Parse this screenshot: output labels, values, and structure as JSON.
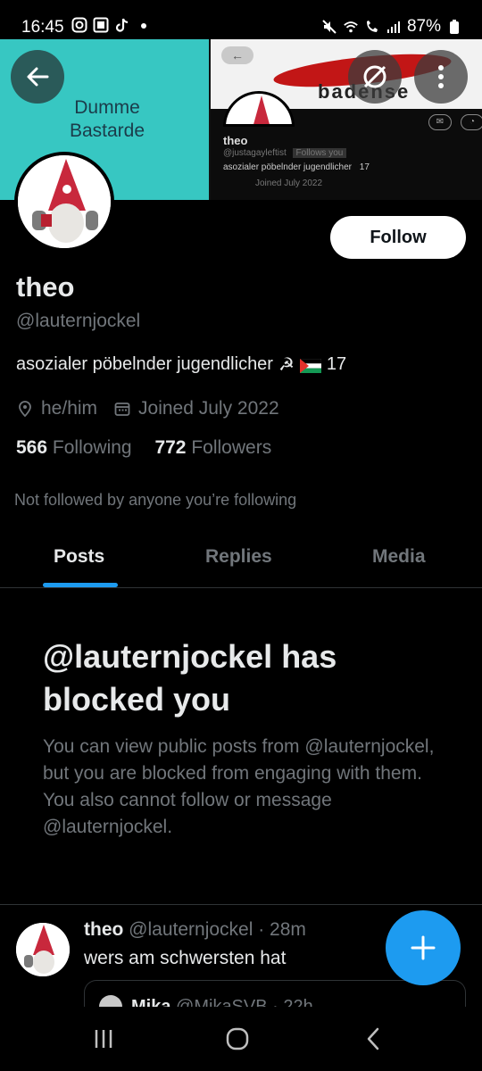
{
  "status_bar": {
    "time": "16:45",
    "battery": "87%",
    "icons_left": [
      "instagram-icon",
      "app-icon",
      "tiktok-icon",
      "dot-icon"
    ],
    "icons_right": [
      "mute-icon",
      "wifi-icon",
      "wifi-call-icon",
      "signal-icon",
      "battery-icon"
    ]
  },
  "banner": {
    "left_text_line1": "Dumme",
    "left_text_line2": "Bastarde",
    "right_image": {
      "caption": "badense",
      "name": "theo",
      "handle": "@justagayleftist",
      "follows_you": "Follows you",
      "bio": "asozialer pöbelnder jugendlicher",
      "age": "17",
      "joined": "Joined July 2022"
    }
  },
  "profile": {
    "name": "theo",
    "handle": "@lauternjockel",
    "bio_text": "asozialer pöbelnder jugendlicher",
    "bio_age": "17",
    "pronouns": "he/him",
    "joined": "Joined July 2022",
    "following_count": "566",
    "following_label": "Following",
    "followers_count": "772",
    "followers_label": "Followers",
    "not_followed": "Not followed by anyone you’re following",
    "follow_button": "Follow"
  },
  "tabs": [
    {
      "label": "Posts",
      "active": true
    },
    {
      "label": "Replies",
      "active": false
    },
    {
      "label": "Media",
      "active": false
    }
  ],
  "blocked": {
    "title": "@lauternjockel has blocked you",
    "text": "You can view public posts from @lauternjockel, but you are blocked from engaging with them. You also cannot follow or message @lauternjockel."
  },
  "tweet": {
    "name": "theo",
    "handle_time": "@lauternjockel · 28m",
    "text": "wers am schwersten hat",
    "quote_name": "Mika",
    "quote_handle_time": "@MikaSVB · 22h"
  },
  "colors": {
    "accent": "#1d9bf0",
    "background": "#000000",
    "muted_text": "#71767b",
    "primary_text": "#e7e9ea"
  }
}
